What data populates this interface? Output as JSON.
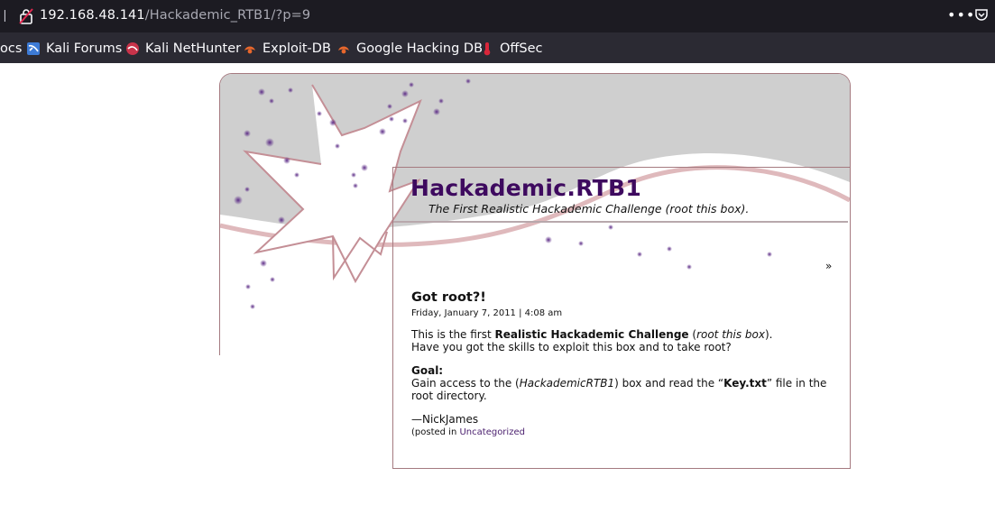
{
  "browser": {
    "url_host": "192.168.48.141",
    "url_path": "/Hackademic_RTB1/?p=9",
    "left_partial_glyph": "?",
    "more_glyph": "•••",
    "bookmarks": [
      {
        "label": "ocs",
        "icon": "none"
      },
      {
        "label": "Kali Forums",
        "icon": "kali-forums-icon"
      },
      {
        "label": "Kali NetHunter",
        "icon": "kali-nethunter-icon"
      },
      {
        "label": "Exploit-DB",
        "icon": "exploit-db-icon"
      },
      {
        "label": "Google Hacking DB",
        "icon": "google-hacking-db-icon"
      },
      {
        "label": "OffSec",
        "icon": "offsec-icon"
      }
    ]
  },
  "blog": {
    "title": "Hackademic.RTB1",
    "description": "The First Realistic Hackademic Challenge (root this box).",
    "raquo": "»"
  },
  "post": {
    "title": "Got root?!",
    "date": "Friday, January 7, 2011 | 4:08 am",
    "intro_prefix": "This is the first ",
    "intro_bold": "Realistic Hackademic Challenge",
    "intro_paren_open": " (",
    "intro_italic": "root this box",
    "intro_paren_close": ").",
    "intro_line2": "Have you got the skills to exploit this box and to take root?",
    "goal_label": "Goal:",
    "goal_prefix": "Gain access to the (",
    "goal_italic": "HackademicRTB1",
    "goal_middle": ") box and read the “",
    "goal_bold": "Key.txt",
    "goal_suffix": "” file in the",
    "goal_line2": "root directory.",
    "signature": "—NickJames",
    "posted_prefix": "(posted in ",
    "category": "Uncategorized"
  },
  "colors": {
    "title": "#3e0a5f",
    "link": "#4a1f6e",
    "border": "#a57a80",
    "chrome_bg": "#1c1b22",
    "bookmarks_bg": "#2b2a33"
  }
}
